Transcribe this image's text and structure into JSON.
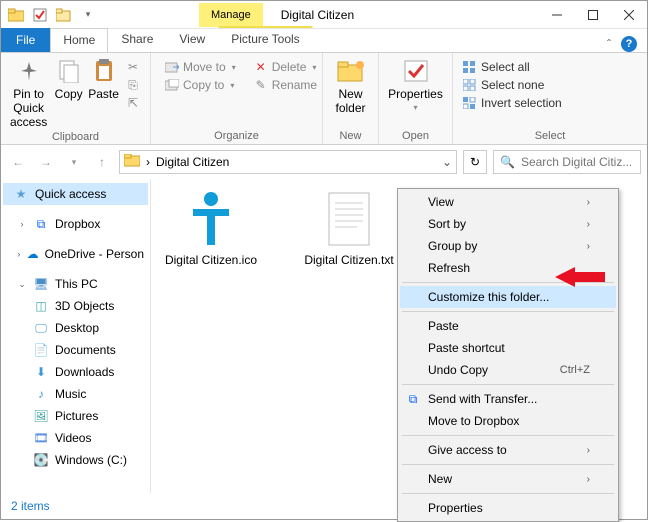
{
  "window": {
    "title": "Digital Citizen"
  },
  "tabs": {
    "file": "File",
    "home": "Home",
    "share": "Share",
    "view": "View",
    "manage": "Manage",
    "picture_tools": "Picture Tools"
  },
  "ribbon": {
    "clipboard": {
      "group": "Clipboard",
      "pin": "Pin to Quick access",
      "copy": "Copy",
      "paste": "Paste"
    },
    "organize": {
      "group": "Organize",
      "move_to": "Move to",
      "copy_to": "Copy to",
      "delete": "Delete",
      "rename": "Rename"
    },
    "new": {
      "group": "New",
      "new_folder": "New folder"
    },
    "open": {
      "group": "Open",
      "properties": "Properties"
    },
    "select": {
      "group": "Select",
      "select_all": "Select all",
      "select_none": "Select none",
      "invert": "Invert selection"
    }
  },
  "nav": {
    "breadcrumb_sep": "›",
    "crumb": "Digital Citizen",
    "search_placeholder": "Search Digital Citiz..."
  },
  "tree": {
    "quick_access": "Quick access",
    "dropbox": "Dropbox",
    "onedrive": "OneDrive - Person",
    "this_pc": "This PC",
    "objects3d": "3D Objects",
    "desktop": "Desktop",
    "documents": "Documents",
    "downloads": "Downloads",
    "music": "Music",
    "pictures": "Pictures",
    "videos": "Videos",
    "windows_c": "Windows (C:)"
  },
  "files": {
    "ico": "Digital Citizen.ico",
    "txt": "Digital Citizen.txt"
  },
  "context_menu": {
    "view": "View",
    "sort_by": "Sort by",
    "group_by": "Group by",
    "refresh": "Refresh",
    "customize": "Customize this folder...",
    "paste": "Paste",
    "paste_shortcut": "Paste shortcut",
    "undo_copy": "Undo Copy",
    "undo_sc": "Ctrl+Z",
    "send_transfer": "Send with Transfer...",
    "move_dropbox": "Move to Dropbox",
    "give_access": "Give access to",
    "new": "New",
    "properties": "Properties"
  },
  "status": {
    "items": "2 items"
  }
}
